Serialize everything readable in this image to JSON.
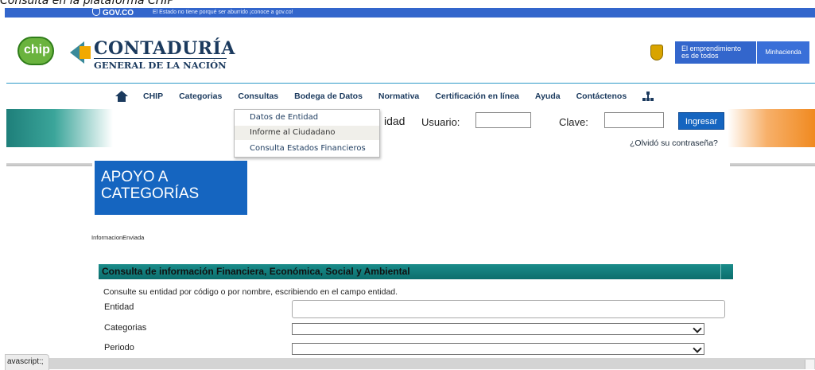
{
  "caption": "Consulta en la plataforma CHIP",
  "govbar": {
    "logo_text": "GOV.CO",
    "message": "El Estado no tiene porqué ser aburrido ¡conoce a gov.co!"
  },
  "header": {
    "chip_logo_text": "chip",
    "title": "CONTADURÍA",
    "subtitle": "GENERAL DE LA NACIÓN",
    "emprendimiento_line1": "El emprendimiento",
    "emprendimiento_line2": "es de todos",
    "minhacienda": "Minhacienda"
  },
  "nav": {
    "items": [
      "CHIP",
      "Categorias",
      "Consultas",
      "Bodega de Datos",
      "Normativa",
      "Certificación en línea",
      "Ayuda",
      "Contáctenos"
    ]
  },
  "dropdown": {
    "items": [
      "Datos de Entidad",
      "Informe al Ciudadano",
      "Consulta Estados Financieros"
    ],
    "hovered_index": 1
  },
  "login": {
    "partial_label": "idad",
    "usuario_label": "Usuario:",
    "usuario_value": "",
    "clave_label": "Clave:",
    "clave_value": "",
    "submit_label": "Ingresar",
    "forgot_label": "¿Olvidó su contraseña?"
  },
  "apoyo": {
    "line1": "APOYO A",
    "line2": "CATEGORÍAS"
  },
  "info_enviada": "InformacionEnviada",
  "consulta": {
    "title": "Consulta de información Financiera, Económica, Social y Ambiental",
    "help": "Consulte su entidad por código o por nombre, escribiendo en el campo entidad.",
    "entidad_label": "Entidad",
    "entidad_value": "",
    "categorias_label": "Categorias",
    "categorias_selected": "",
    "periodo_label": "Periodo",
    "periodo_selected": ""
  },
  "status": {
    "link_preview": "avascript:;"
  },
  "colors": {
    "gov_blue": "#3366cc",
    "navy": "#1b3a5e",
    "button_blue": "#1565c0",
    "teal": "#0c6e6d",
    "orange": "#f08a20"
  }
}
